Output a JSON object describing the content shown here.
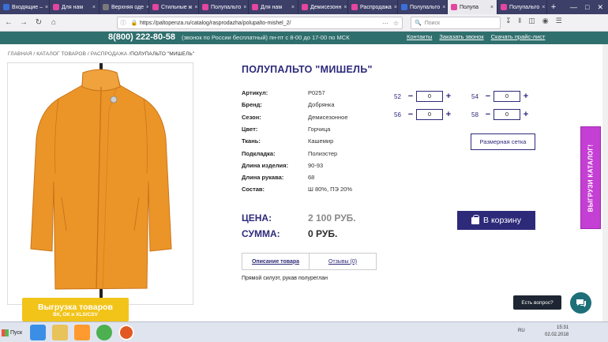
{
  "browser": {
    "tabs": [
      {
        "label": "Входящие – ",
        "color": "#3b6fd8"
      },
      {
        "label": "Для нам",
        "color": "#e4459e"
      },
      {
        "label": "Верхняя оде",
        "color": "#7a7a7a"
      },
      {
        "label": "Стильные ж",
        "color": "#e4459e"
      },
      {
        "label": "Полупальто",
        "color": "#e4459e"
      },
      {
        "label": "Для нам",
        "color": "#e4459e"
      },
      {
        "label": "Демисезонн",
        "color": "#e4459e"
      },
      {
        "label": "Распродажа",
        "color": "#e4459e"
      },
      {
        "label": "Полупальто",
        "color": "#3b6fd8"
      },
      {
        "label": "Полупа",
        "color": "#e4459e",
        "active": true
      },
      {
        "label": "Полупальто",
        "color": "#e4459e"
      }
    ],
    "url": "https://paltopenza.ru/catalog/rasprodazha/polupalto-mishel_2/",
    "search_placeholder": "Поиск"
  },
  "site": {
    "phone": "8(800) 222-80-58",
    "phone_note": "(звонок по России бесплатный) пн-пт с 8-00 до 17-00 по МСК",
    "links": [
      "Контакты",
      "Заказать звонок",
      "Скачать прайс-лист"
    ]
  },
  "breadcrumb": {
    "path": "ГЛАВНАЯ / КАТАЛОГ ТОВАРОВ / РАСПРОДАЖА /",
    "current": "ПОЛУПАЛЬТО \"МИШЕЛЬ\""
  },
  "product": {
    "title": "ПОЛУПАЛЬТО \"МИШЕЛЬ\"",
    "coat_color": "#eb9528",
    "specs": [
      {
        "key": "Артикул:",
        "value": "Р0257"
      },
      {
        "key": "Бренд:",
        "value": "Добрянка"
      },
      {
        "key": "Сезон:",
        "value": "Демисезонное"
      },
      {
        "key": "Цвет:",
        "value": "Горчица"
      },
      {
        "key": "Ткань:",
        "value": "Кашемир"
      },
      {
        "key": "Подкладка:",
        "value": "Полиэстер"
      },
      {
        "key": "Длина изделия:",
        "value": "90-93"
      },
      {
        "key": "Длина рукава:",
        "value": "68"
      },
      {
        "key": "Состав:",
        "value": "Ш 80%, ПЭ 20%"
      }
    ],
    "sizes": [
      {
        "size": "52",
        "qty": "0"
      },
      {
        "size": "54",
        "qty": "0"
      },
      {
        "size": "56",
        "qty": "0"
      },
      {
        "size": "58",
        "qty": "0"
      }
    ],
    "size_chart_label": "Размерная сетка",
    "price_label": "ЦЕНА:",
    "price_value": "2 100 РУБ.",
    "sum_label": "СУММА:",
    "sum_value": "0 РУБ.",
    "cart_label": "В корзину",
    "tabs": [
      "Описание товара",
      "Отзывы (0)"
    ],
    "description": "Прямой силуэт, рукав полуреглан"
  },
  "widgets": {
    "catalog_side": "ВЫГРУЗИ КАТАЛОГ!",
    "export_line1": "Выгрузка товаров",
    "export_line2": "ВК, ОК и XLS/CSV",
    "question": "Есть вопрос?"
  },
  "taskbar": {
    "start_label": "Пуск",
    "lang": "RU",
    "time": "15:31",
    "date": "02.02.2018"
  },
  "colors": {
    "brand": "#2d2a7a",
    "top_bar": "#2f6f6d",
    "price_grey": "#8a8a8a",
    "sum_dark": "#2b2b2b",
    "side_tab": "#c43fd3",
    "export": "#f2c41a"
  }
}
